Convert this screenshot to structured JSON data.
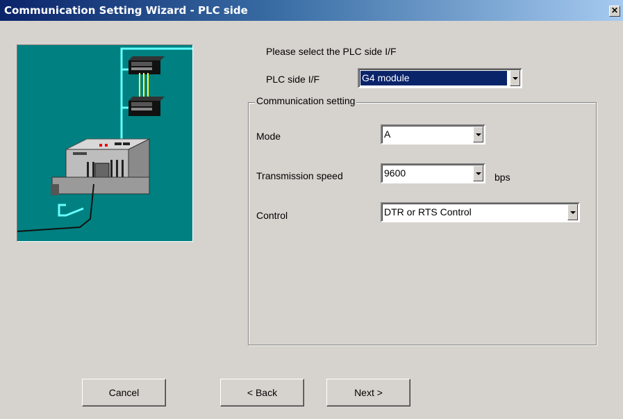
{
  "window": {
    "title": "Communication Setting Wizard - PLC side",
    "close_glyph": "✕"
  },
  "prompt": "Please select the PLC side I/F",
  "plc_side_if": {
    "label": "PLC side I/F",
    "value": "G4 module"
  },
  "communication_setting": {
    "legend": "Communication setting",
    "mode": {
      "label": "Mode",
      "value": "A"
    },
    "speed": {
      "label": "Transmission speed",
      "value": "9600",
      "unit": "bps"
    },
    "control": {
      "label": "Control",
      "value": "DTR or RTS Control"
    }
  },
  "buttons": {
    "cancel": "Cancel",
    "back": "< Back",
    "next": "Next >"
  },
  "colors": {
    "titlebar_start": "#0a246a",
    "dialog_bg": "#d6d3ce",
    "image_bg": "#008080"
  },
  "illustration": "plc-network-icon"
}
